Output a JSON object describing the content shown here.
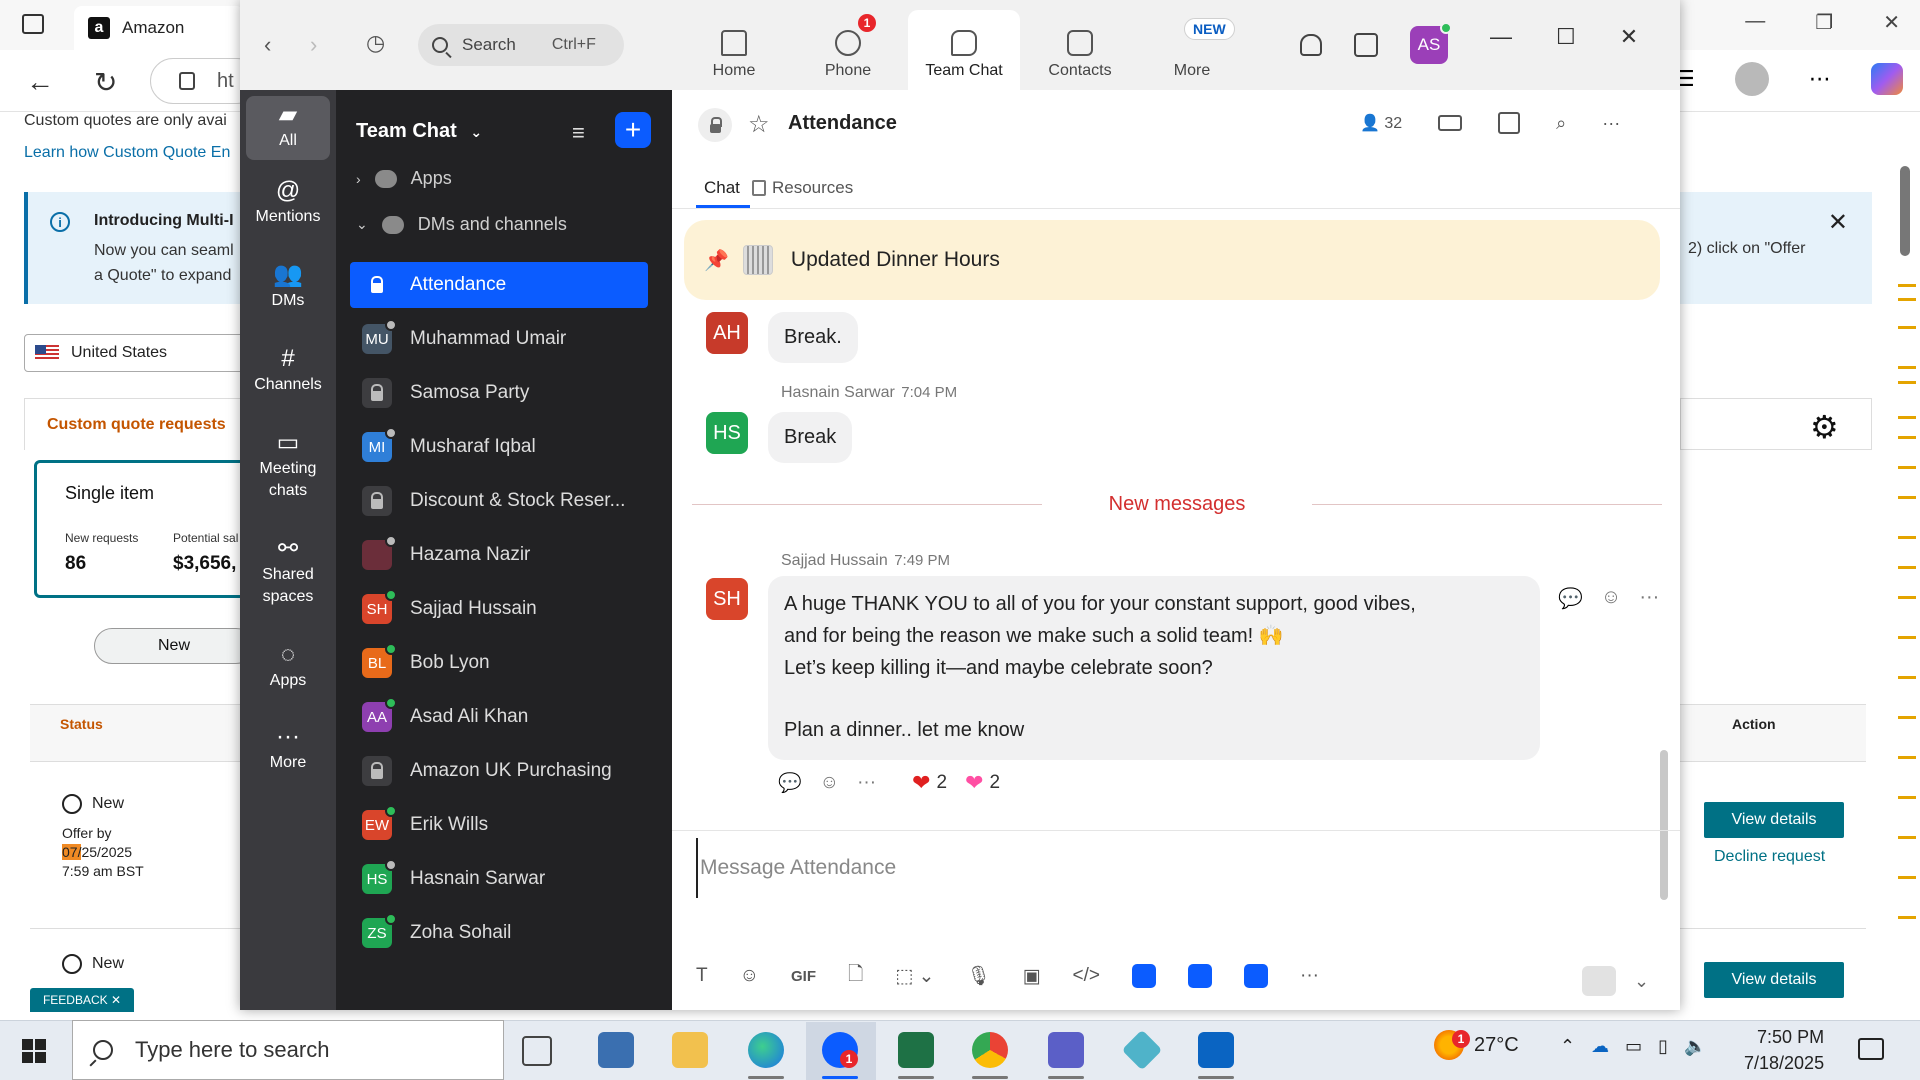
{
  "browser": {
    "tab_title": "Amazon",
    "tab_favicon": "a",
    "url_partial": "ht",
    "page": {
      "quote_note": "Custom quotes are only avai",
      "learn_link": "Learn how Custom Quote En",
      "info_title": "Introducing Multi-I",
      "info_line1": "Now you can seaml",
      "info_line2": "a Quote\" to expand",
      "info_right": "2) click on \"Offer",
      "country": "United States",
      "subtab": "Custom quote requests",
      "card_title": "Single item",
      "card_label1": "New requests",
      "card_value1": "86",
      "card_label2": "Potential sal",
      "card_value2": "$3,656,",
      "new_pill": "New",
      "th_status": "Status",
      "th_action": "Action",
      "row1_status": "New",
      "row1_offer_by": "Offer by",
      "row1_date_hl": "07/",
      "row1_date_rest": "25/2025",
      "row1_time": "7:59 am BST",
      "row2_status": "New",
      "view_details": "View details",
      "decline": "Decline request",
      "feedback": "FEEDBACK ✕"
    }
  },
  "zoom": {
    "search_placeholder": "Search",
    "search_shortcut": "Ctrl+F",
    "nav": [
      {
        "label": "Home",
        "badge": ""
      },
      {
        "label": "Phone",
        "badge": "1"
      },
      {
        "label": "Team Chat",
        "badge": ""
      },
      {
        "label": "Contacts",
        "badge": ""
      },
      {
        "label": "More",
        "badge": "NEW"
      }
    ],
    "avatar": "AS",
    "rail": [
      {
        "label": "All"
      },
      {
        "label": "Mentions"
      },
      {
        "label": "DMs"
      },
      {
        "label": "Channels"
      },
      {
        "label": "Meeting chats"
      },
      {
        "label": "Shared spaces"
      },
      {
        "label": "Apps"
      },
      {
        "label": "More"
      }
    ],
    "sidebar": {
      "title": "Team Chat",
      "sections": {
        "apps": "Apps",
        "dms": "DMs and channels"
      },
      "channels": [
        {
          "initials": "",
          "name": "Attendance",
          "color": "#0b5cff",
          "lock": true
        },
        {
          "initials": "MU",
          "name": "Muhammad Umair",
          "color": "#445566",
          "lock": false
        },
        {
          "initials": "",
          "name": "Samosa Party",
          "color": "#3d3d40",
          "lock": true
        },
        {
          "initials": "MI",
          "name": "Musharaf Iqbal",
          "color": "#2f7fd8",
          "lock": false
        },
        {
          "initials": "",
          "name": "Discount & Stock Reser...",
          "color": "#3d3d40",
          "lock": true
        },
        {
          "initials": "",
          "name": "Hazama Nazir",
          "color": "#6b2e3a",
          "lock": false
        },
        {
          "initials": "SH",
          "name": "Sajjad Hussain",
          "color": "#d9452b",
          "lock": false
        },
        {
          "initials": "BL",
          "name": "Bob Lyon",
          "color": "#e86a1a",
          "lock": false
        },
        {
          "initials": "AA",
          "name": "Asad Ali Khan",
          "color": "#8e3fb0",
          "lock": false
        },
        {
          "initials": "",
          "name": "Amazon UK Purchasing",
          "color": "#3d3d40",
          "lock": true
        },
        {
          "initials": "EW",
          "name": "Erik Wills",
          "color": "#d9452b",
          "lock": false
        },
        {
          "initials": "HS",
          "name": "Hasnain Sarwar",
          "color": "#1fa653",
          "lock": false
        },
        {
          "initials": "ZS",
          "name": "Zoha Sohail",
          "color": "#1fa653",
          "lock": false
        }
      ]
    },
    "chat": {
      "title": "Attendance",
      "members": "32",
      "tabs": {
        "chat": "Chat",
        "resources": "Resources"
      },
      "pinned": "Updated Dinner Hours",
      "messages": [
        {
          "initials": "AH",
          "sender": "",
          "time": "",
          "text": "Break."
        },
        {
          "initials": "HS",
          "sender": "Hasnain Sarwar",
          "time": "7:04 PM",
          "text": "Break"
        }
      ],
      "new_messages": "New messages",
      "latest": {
        "initials": "SH",
        "sender": "Sajjad Hussain",
        "time": "7:49 PM",
        "line1": "A huge THANK YOU to all of you for your constant support, good vibes,",
        "line2": "and for being the reason we make such a solid team! 🙌",
        "line3": "Let’s keep killing it—and maybe celebrate soon?",
        "line4": "Plan a dinner.. let me know",
        "reaction1_count": "2",
        "reaction2_count": "2"
      },
      "composer_placeholder": "Message Attendance",
      "toolbar_gif": "GIF"
    }
  },
  "taskbar": {
    "search": "Type here to search",
    "weather": "27°C",
    "weather_badge": "1",
    "zoom_badge": "1",
    "time": "7:50 PM",
    "date": "7/18/2025"
  }
}
